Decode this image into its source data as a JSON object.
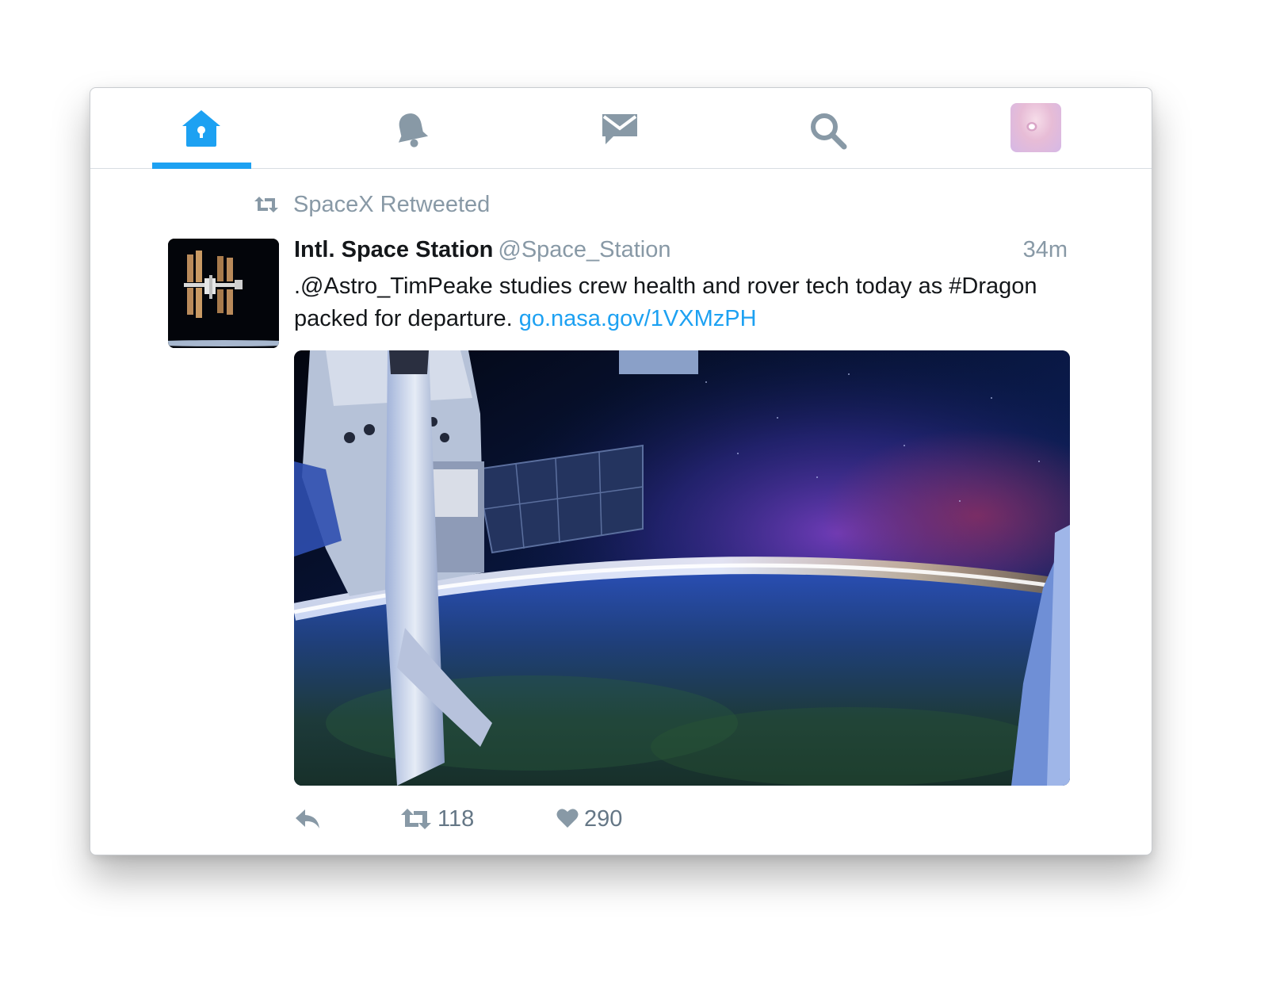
{
  "nav": {
    "items": [
      {
        "name": "home",
        "icon": "home-icon",
        "active": true
      },
      {
        "name": "notifications",
        "icon": "bell-icon",
        "active": false
      },
      {
        "name": "messages",
        "icon": "envelope-icon",
        "active": false
      },
      {
        "name": "search",
        "icon": "search-icon",
        "active": false
      },
      {
        "name": "profile",
        "icon": "avatar",
        "active": false
      }
    ],
    "active_color": "#1da1f2",
    "inactive_color": "#8899a6"
  },
  "tweet": {
    "retweet_context": "SpaceX Retweeted",
    "author_name": "Intl. Space Station",
    "author_handle": "@Space_Station",
    "timestamp": "34m",
    "text": ".@Astro_TimPeake studies crew health and rover tech today as #Dragon packed for departure.",
    "link": "go.nasa.gov/1VXMzPH",
    "media_icon": "earth-from-iss-photo",
    "retweet_count": "118",
    "like_count": "290"
  },
  "colors": {
    "link": "#1da1f2",
    "secondary_text": "#8899a6",
    "primary_text": "#14171a"
  }
}
